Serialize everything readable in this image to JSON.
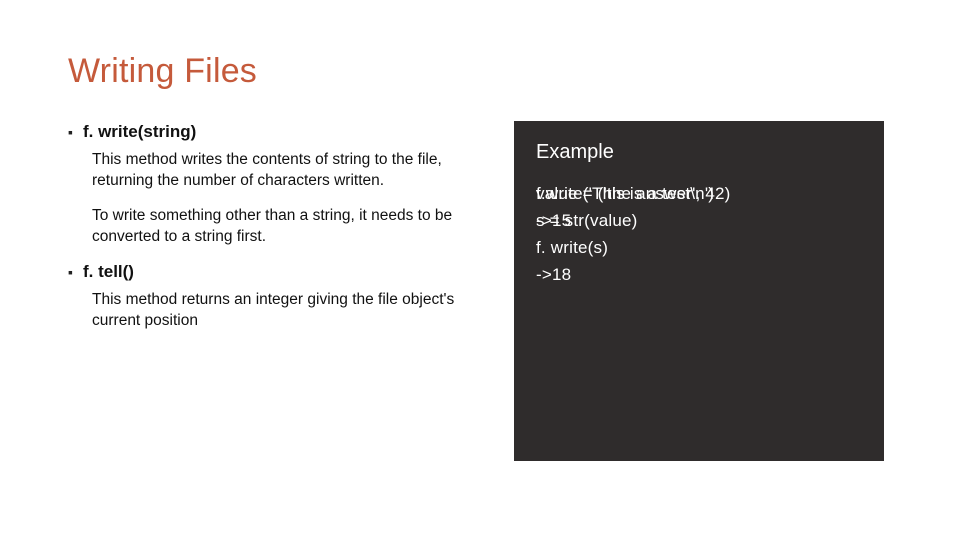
{
  "title": "Writing Files",
  "bullets": [
    {
      "mark": "▪",
      "head": "f. write(string)",
      "descs": [
        "This method writes the contents of string to the file, returning the number of characters written.",
        "To write something other than a string, it needs to be converted to a string first."
      ]
    },
    {
      "mark": "▪",
      "head": "f. tell()",
      "descs": [
        "This method returns an integer giving the file object's current position"
      ]
    }
  ],
  "panel": {
    "title": "Example",
    "code_lines": [
      {
        "a": "f.write('This is a test\\n')",
        "b": "value = ('the answer', 42)"
      },
      {
        "a": "->15",
        "b": "s = str(value)"
      },
      {
        "a": "f. write(s)",
        "b": ""
      },
      {
        "a": "->18",
        "b": ""
      }
    ]
  }
}
